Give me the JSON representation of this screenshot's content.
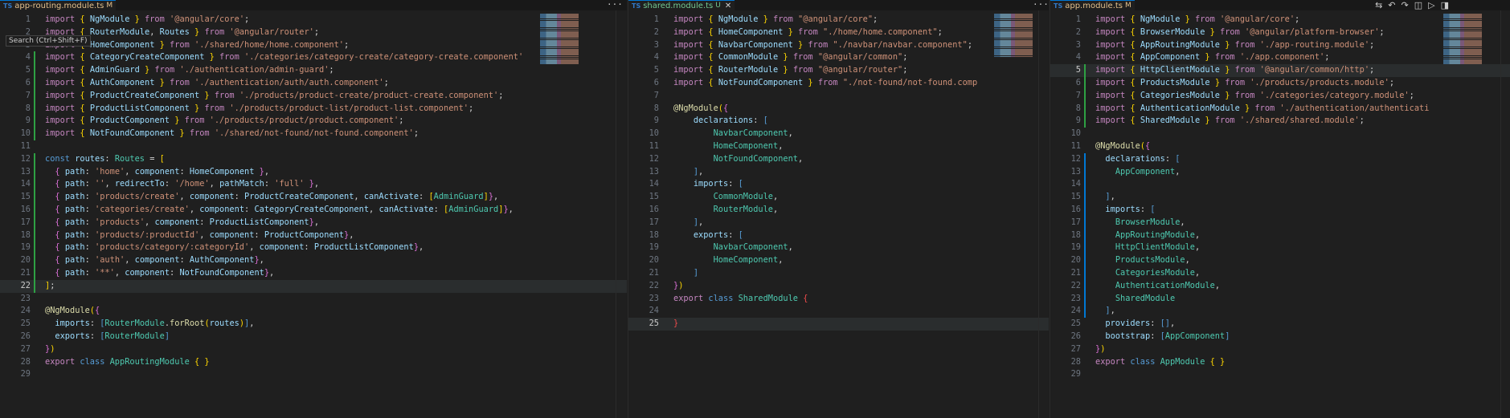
{
  "tooltip": "Search (Ctrl+Shift+F)",
  "panes": [
    {
      "tab": {
        "name": "app-routing.module.ts",
        "status": "M",
        "icon": "TS"
      },
      "more": "···",
      "active_line": 22,
      "lines": [
        {
          "n": "1",
          "html": "<span class='k'>import</span> <span class='brc'>{</span> <span class='p'>NgModule</span> <span class='brc'>}</span> <span class='k'>from</span> <span class='s'>'@angular/core'</span><span class='pl'>;</span>"
        },
        {
          "n": "2",
          "html": "<span class='k'>import</span> <span class='brc'>{</span> <span class='p'>RouterModule</span><span class='pl'>,</span> <span class='p'>Routes</span> <span class='brc'>}</span> <span class='k'>from</span> <span class='s'>'@angular/router'</span><span class='pl'>;</span>"
        },
        {
          "n": "3",
          "html": "<span class='k'>import</span> <span class='brc'>{</span> <span class='p'>HomeComponent</span> <span class='brc'>}</span> <span class='k'>from</span> <span class='s'>'./shared/home/home.component'</span><span class='pl'>;</span>"
        },
        {
          "n": "4",
          "html": "<span class='k'>import</span> <span class='brc'>{</span> <span class='p'>CategoryCreateComponent</span> <span class='brc'>}</span> <span class='k'>from</span> <span class='s'>'./categories/category-create/category-create.component'</span>"
        },
        {
          "n": "5",
          "html": "<span class='k'>import</span> <span class='brc'>{</span> <span class='p'>AdminGuard</span> <span class='brc'>}</span> <span class='k'>from</span> <span class='s'>'./authentication/admin-guard'</span><span class='pl'>;</span>"
        },
        {
          "n": "6",
          "html": "<span class='k'>import</span> <span class='brc'>{</span> <span class='p'>AuthComponent</span> <span class='brc'>}</span> <span class='k'>from</span> <span class='s'>'./authentication/auth/auth.component'</span><span class='pl'>;</span>"
        },
        {
          "n": "7",
          "html": "<span class='k'>import</span> <span class='brc'>{</span> <span class='p'>ProductCreateComponent</span> <span class='brc'>}</span> <span class='k'>from</span> <span class='s'>'./products/product-create/product-create.component'</span><span class='pl'>;</span>"
        },
        {
          "n": "8",
          "html": "<span class='k'>import</span> <span class='brc'>{</span> <span class='p'>ProductListComponent</span> <span class='brc'>}</span> <span class='k'>from</span> <span class='s'>'./products/product-list/product-list.component'</span><span class='pl'>;</span>"
        },
        {
          "n": "9",
          "html": "<span class='k'>import</span> <span class='brc'>{</span> <span class='p'>ProductComponent</span> <span class='brc'>}</span> <span class='k'>from</span> <span class='s'>'./products/product/product.component'</span><span class='pl'>;</span>"
        },
        {
          "n": "10",
          "html": "<span class='k'>import</span> <span class='brc'>{</span> <span class='p'>NotFoundComponent</span> <span class='brc'>}</span> <span class='k'>from</span> <span class='s'>'./shared/not-found/not-found.component'</span><span class='pl'>;</span>"
        },
        {
          "n": "11",
          "html": ""
        },
        {
          "n": "12",
          "html": "<span class='kb'>const</span> <span class='p'>routes</span><span class='pl'>:</span> <span class='cl'>Routes</span> <span class='pl'>=</span> <span class='brc'>[</span>"
        },
        {
          "n": "13",
          "html": "  <span class='br'>{</span> <span class='p'>path</span><span class='pl'>:</span> <span class='s'>'home'</span><span class='pl'>,</span> <span class='p'>component</span><span class='pl'>:</span> <span class='p'>HomeComponent</span> <span class='br'>}</span><span class='pl'>,</span>"
        },
        {
          "n": "14",
          "html": "  <span class='br'>{</span> <span class='p'>path</span><span class='pl'>:</span> <span class='s'>''</span><span class='pl'>,</span> <span class='p'>redirectTo</span><span class='pl'>:</span> <span class='s'>'/home'</span><span class='pl'>,</span> <span class='p'>pathMatch</span><span class='pl'>:</span> <span class='s'>'full'</span> <span class='br'>}</span><span class='pl'>,</span>"
        },
        {
          "n": "15",
          "html": "  <span class='br'>{</span> <span class='p'>path</span><span class='pl'>:</span> <span class='s'>'products/create'</span><span class='pl'>,</span> <span class='p'>component</span><span class='pl'>:</span> <span class='p'>ProductCreateComponent</span><span class='pl'>,</span> <span class='p'>canActivate</span><span class='pl'>:</span> <span class='brc'>[</span><span class='cl'>AdminGuard</span><span class='brc'>]</span><span class='br'>}</span><span class='pl'>,</span>"
        },
        {
          "n": "16",
          "html": "  <span class='br'>{</span> <span class='p'>path</span><span class='pl'>:</span> <span class='s'>'categories/create'</span><span class='pl'>,</span> <span class='p'>component</span><span class='pl'>:</span> <span class='p'>CategoryCreateComponent</span><span class='pl'>,</span> <span class='p'>canActivate</span><span class='pl'>:</span> <span class='brc'>[</span><span class='cl'>AdminGuard</span><span class='brc'>]</span><span class='br'>}</span><span class='pl'>,</span>"
        },
        {
          "n": "17",
          "html": "  <span class='br'>{</span> <span class='p'>path</span><span class='pl'>:</span> <span class='s'>'products'</span><span class='pl'>,</span> <span class='p'>component</span><span class='pl'>:</span> <span class='p'>ProductListComponent</span><span class='br'>}</span><span class='pl'>,</span>"
        },
        {
          "n": "18",
          "html": "  <span class='br'>{</span> <span class='p'>path</span><span class='pl'>:</span> <span class='s'>'products/:productId'</span><span class='pl'>,</span> <span class='p'>component</span><span class='pl'>:</span> <span class='p'>ProductComponent</span><span class='br'>}</span><span class='pl'>,</span>"
        },
        {
          "n": "19",
          "html": "  <span class='br'>{</span> <span class='p'>path</span><span class='pl'>:</span> <span class='s'>'products/category/:categoryId'</span><span class='pl'>,</span> <span class='p'>component</span><span class='pl'>:</span> <span class='p'>ProductListComponent</span><span class='br'>}</span><span class='pl'>,</span>"
        },
        {
          "n": "20",
          "html": "  <span class='br'>{</span> <span class='p'>path</span><span class='pl'>:</span> <span class='s'>'auth'</span><span class='pl'>,</span> <span class='p'>component</span><span class='pl'>:</span> <span class='p'>AuthComponent</span><span class='br'>}</span><span class='pl'>,</span>"
        },
        {
          "n": "21",
          "html": "  <span class='br'>{</span> <span class='p'>path</span><span class='pl'>:</span> <span class='s'>'**'</span><span class='pl'>,</span> <span class='p'>component</span><span class='pl'>:</span> <span class='p'>NotFoundComponent</span><span class='br'>}</span><span class='pl'>,</span>"
        },
        {
          "n": "22",
          "html": "<span class='brc'>]</span><span class='pl'>;</span>"
        },
        {
          "n": "23",
          "html": ""
        },
        {
          "n": "24",
          "html": "<span class='dec'>@NgModule</span><span class='brc'>(</span><span class='br'>{</span>"
        },
        {
          "n": "25",
          "html": "  <span class='p'>imports</span><span class='pl'>:</span> <span class='kb'>[</span><span class='cl'>RouterModule</span><span class='pl'>.</span><span class='fn'>forRoot</span><span class='brc'>(</span><span class='p'>routes</span><span class='brc'>)</span><span class='kb'>]</span><span class='pl'>,</span>"
        },
        {
          "n": "26",
          "html": "  <span class='p'>exports</span><span class='pl'>:</span> <span class='kb'>[</span><span class='cl'>RouterModule</span><span class='kb'>]</span>"
        },
        {
          "n": "27",
          "html": "<span class='br'>}</span><span class='brc'>)</span>"
        },
        {
          "n": "28",
          "html": "<span class='k'>export</span> <span class='kb'>class</span> <span class='cl'>AppRoutingModule</span> <span class='brc'>{</span> <span class='brc'>}</span>"
        },
        {
          "n": "29",
          "html": ""
        }
      ]
    },
    {
      "tab": {
        "name": "shared.module.ts",
        "status": "U",
        "icon": "TS"
      },
      "more": "···",
      "active_line": 25,
      "lines": [
        {
          "n": "1",
          "html": "<span class='k'>import</span> <span class='brc'>{</span> <span class='p'>NgModule</span> <span class='brc'>}</span> <span class='k'>from</span> <span class='s'>\"@angular/core\"</span><span class='pl'>;</span>"
        },
        {
          "n": "2",
          "html": "<span class='k'>import</span> <span class='brc'>{</span> <span class='p'>HomeComponent</span> <span class='brc'>}</span> <span class='k'>from</span> <span class='s'>\"./home/home.component\"</span><span class='pl'>;</span>"
        },
        {
          "n": "3",
          "html": "<span class='k'>import</span> <span class='brc'>{</span> <span class='p'>NavbarComponent</span> <span class='brc'>}</span> <span class='k'>from</span> <span class='s'>\"./navbar/navbar.component\"</span><span class='pl'>;</span>"
        },
        {
          "n": "4",
          "html": "<span class='k'>import</span> <span class='brc'>{</span> <span class='p'>CommonModule</span> <span class='brc'>}</span> <span class='k'>from</span> <span class='s'>\"@angular/common\"</span><span class='pl'>;</span>"
        },
        {
          "n": "5",
          "html": "<span class='k'>import</span> <span class='brc'>{</span> <span class='p'>RouterModule</span> <span class='brc'>}</span> <span class='k'>from</span> <span class='s'>\"@angular/router\"</span><span class='pl'>;</span>"
        },
        {
          "n": "6",
          "html": "<span class='k'>import</span> <span class='brc'>{</span> <span class='p'>NotFoundComponent</span> <span class='brc'>}</span> <span class='k'>from</span> <span class='s'>\"./not-found/not-found.comp</span>"
        },
        {
          "n": "7",
          "html": ""
        },
        {
          "n": "8",
          "html": "<span class='dec'>@NgModule</span><span class='brc'>(</span><span class='br'>{</span>"
        },
        {
          "n": "9",
          "html": "    <span class='p'>declarations</span><span class='pl'>:</span> <span class='kb'>[</span>"
        },
        {
          "n": "10",
          "html": "        <span class='cl'>NavbarComponent</span><span class='pl'>,</span>"
        },
        {
          "n": "11",
          "html": "        <span class='cl'>HomeComponent</span><span class='pl'>,</span>"
        },
        {
          "n": "12",
          "html": "        <span class='cl'>NotFoundComponent</span><span class='pl'>,</span>"
        },
        {
          "n": "13",
          "html": "    <span class='kb'>]</span><span class='pl'>,</span>"
        },
        {
          "n": "14",
          "html": "    <span class='p'>imports</span><span class='pl'>:</span> <span class='kb'>[</span>"
        },
        {
          "n": "15",
          "html": "        <span class='cl'>CommonModule</span><span class='pl'>,</span>"
        },
        {
          "n": "16",
          "html": "        <span class='cl'>RouterModule</span><span class='pl'>,</span>"
        },
        {
          "n": "17",
          "html": "    <span class='kb'>]</span><span class='pl'>,</span>"
        },
        {
          "n": "18",
          "html": "    <span class='p'>exports</span><span class='pl'>:</span> <span class='kb'>[</span>"
        },
        {
          "n": "19",
          "html": "        <span class='cl'>NavbarComponent</span><span class='pl'>,</span>"
        },
        {
          "n": "20",
          "html": "        <span class='cl'>HomeComponent</span><span class='pl'>,</span>"
        },
        {
          "n": "21",
          "html": "    <span class='kb'>]</span>"
        },
        {
          "n": "22",
          "html": "<span class='br'>}</span><span class='brc'>)</span>"
        },
        {
          "n": "23",
          "html": "<span class='k'>export</span> <span class='kb'>class</span> <span class='cl'>SharedModule</span> <span class='errbr'>{</span>"
        },
        {
          "n": "24",
          "html": ""
        },
        {
          "n": "25",
          "html": "<span class='errbr'>}</span>"
        }
      ]
    },
    {
      "tab": {
        "name": "app.module.ts",
        "status": "M",
        "icon": "TS"
      },
      "more": "···",
      "active_line": 5,
      "lines": [
        {
          "n": "1",
          "html": "<span class='k'>import</span> <span class='brc'>{</span> <span class='p'>NgModule</span> <span class='brc'>}</span> <span class='k'>from</span> <span class='s'>'@angular/core'</span><span class='pl'>;</span>"
        },
        {
          "n": "2",
          "html": "<span class='k'>import</span> <span class='brc'>{</span> <span class='p'>BrowserModule</span> <span class='brc'>}</span> <span class='k'>from</span> <span class='s'>'@angular/platform-browser'</span><span class='pl'>;</span>"
        },
        {
          "n": "3",
          "html": "<span class='k'>import</span> <span class='brc'>{</span> <span class='p'>AppRoutingModule</span> <span class='brc'>}</span> <span class='k'>from</span> <span class='s'>'./app-routing.module'</span><span class='pl'>;</span>"
        },
        {
          "n": "4",
          "html": "<span class='k'>import</span> <span class='brc'>{</span> <span class='p'>AppComponent</span> <span class='brc'>}</span> <span class='k'>from</span> <span class='s'>'./app.component'</span><span class='pl'>;</span>"
        },
        {
          "n": "5",
          "html": "<span class='k'>import</span> <span class='brc'>{</span> <span class='p'>HttpClientModule</span> <span class='brc'>}</span> <span class='k'>from</span> <span class='s'>'@angular/common/http'</span><span class='pl'>;</span>"
        },
        {
          "n": "6",
          "html": "<span class='k'>import</span> <span class='brc'>{</span> <span class='p'>ProductsModule</span> <span class='brc'>}</span> <span class='k'>from</span> <span class='s'>'./products/products.module'</span><span class='pl'>;</span>"
        },
        {
          "n": "7",
          "html": "<span class='k'>import</span> <span class='brc'>{</span> <span class='p'>CategoriesModule</span> <span class='brc'>}</span> <span class='k'>from</span> <span class='s'>'./categories/category.module'</span><span class='pl'>;</span>"
        },
        {
          "n": "8",
          "html": "<span class='k'>import</span> <span class='brc'>{</span> <span class='p'>AuthenticationModule</span> <span class='brc'>}</span> <span class='k'>from</span> <span class='s'>'./authentication/authenticati</span>"
        },
        {
          "n": "9",
          "html": "<span class='k'>import</span> <span class='brc'>{</span> <span class='p'>SharedModule</span> <span class='brc'>}</span> <span class='k'>from</span> <span class='s'>'./shared/shared.module'</span><span class='pl'>;</span>"
        },
        {
          "n": "10",
          "html": ""
        },
        {
          "n": "11",
          "html": "<span class='dec'>@NgModule</span><span class='brc'>(</span><span class='br'>{</span>"
        },
        {
          "n": "12",
          "html": "  <span class='p'>declarations</span><span class='pl'>:</span> <span class='kb'>[</span>"
        },
        {
          "n": "13",
          "html": "    <span class='cl'>AppComponent</span><span class='pl'>,</span>"
        },
        {
          "n": "14",
          "html": ""
        },
        {
          "n": "15",
          "html": "  <span class='kb'>]</span><span class='pl'>,</span>"
        },
        {
          "n": "16",
          "html": "  <span class='p'>imports</span><span class='pl'>:</span> <span class='kb'>[</span>"
        },
        {
          "n": "17",
          "html": "    <span class='cl'>BrowserModule</span><span class='pl'>,</span>"
        },
        {
          "n": "18",
          "html": "    <span class='cl'>AppRoutingModule</span><span class='pl'>,</span>"
        },
        {
          "n": "19",
          "html": "    <span class='cl'>HttpClientModule</span><span class='pl'>,</span>"
        },
        {
          "n": "20",
          "html": "    <span class='cl'>ProductsModule</span><span class='pl'>,</span>"
        },
        {
          "n": "21",
          "html": "    <span class='cl'>CategoriesModule</span><span class='pl'>,</span>"
        },
        {
          "n": "22",
          "html": "    <span class='cl'>AuthenticationModule</span><span class='pl'>,</span>"
        },
        {
          "n": "23",
          "html": "    <span class='cl'>SharedModule</span>"
        },
        {
          "n": "24",
          "html": "  <span class='kb'>]</span><span class='pl'>,</span>"
        },
        {
          "n": "25",
          "html": "  <span class='p'>providers</span><span class='pl'>:</span> <span class='kb'>[]</span><span class='pl'>,</span>"
        },
        {
          "n": "26",
          "html": "  <span class='p'>bootstrap</span><span class='pl'>:</span> <span class='kb'>[</span><span class='cl'>AppComponent</span><span class='kb'>]</span>"
        },
        {
          "n": "27",
          "html": "<span class='br'>}</span><span class='brc'>)</span>"
        },
        {
          "n": "28",
          "html": "<span class='k'>export</span> <span class='kb'>class</span> <span class='cl'>AppModule</span> <span class='brc'>{</span> <span class='brc'>}</span>"
        },
        {
          "n": "29",
          "html": ""
        }
      ]
    }
  ],
  "toolbar_icons": [
    "compare-changes-icon",
    "go-back-icon",
    "go-forward-icon",
    "split-editor-icon",
    "run-icon",
    "open-preview-icon"
  ],
  "colors": {
    "accent": "#0078d4",
    "editor_bg": "#1f1f1f",
    "tab_bg": "#181818",
    "added": "#2ea043",
    "modified_tab": "#e2c08d"
  }
}
